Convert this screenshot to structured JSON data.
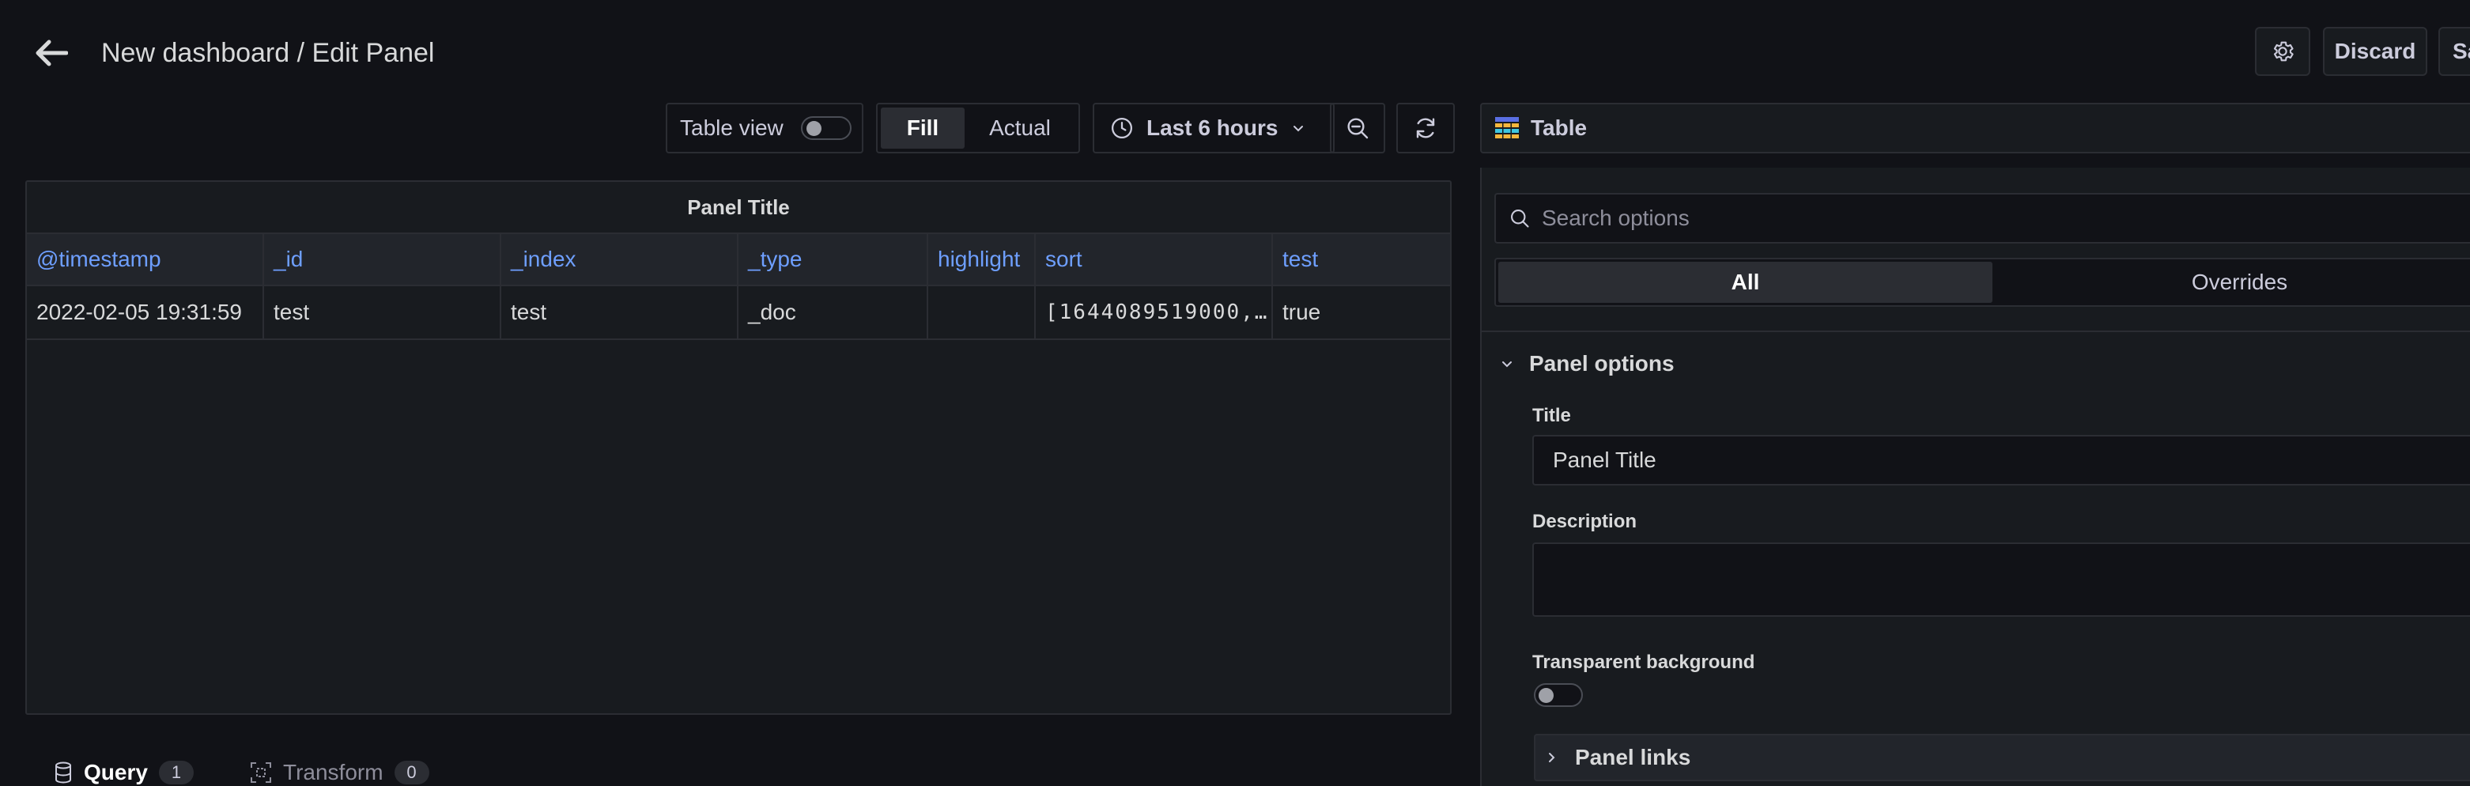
{
  "header": {
    "title": "New dashboard / Edit Panel",
    "discard_label": "Discard",
    "save_label": "Save"
  },
  "toolbar": {
    "table_view_label": "Table view",
    "table_view_on": false,
    "fill_label": "Fill",
    "actual_label": "Actual",
    "time_range_label": "Last 6 hours"
  },
  "panel": {
    "title": "Panel Title",
    "columns": [
      "@timestamp",
      "_id",
      "_index",
      "_type",
      "highlight",
      "sort",
      "test"
    ],
    "rows": [
      [
        "2022-02-05 19:31:59",
        "test",
        "test",
        "_doc",
        "",
        "[1644089519000,…",
        "true"
      ]
    ]
  },
  "bottom_tabs": {
    "query_label": "Query",
    "query_count": "1",
    "transform_label": "Transform",
    "transform_count": "0"
  },
  "options": {
    "visualization_label": "Table",
    "search_placeholder": "Search options",
    "all_label": "All",
    "overrides_label": "Overrides",
    "section_title": "Panel options",
    "title_label": "Title",
    "title_value": "Panel Title",
    "description_label": "Description",
    "description_value": "",
    "transparent_label": "Transparent background",
    "transparent_on": false,
    "panel_links_label": "Panel links"
  },
  "colors": {
    "background": "#111217",
    "panel": "#181b1f",
    "border": "#2b2d33",
    "column_header_text": "#6e9fff"
  },
  "icons": [
    "arrow-left-icon",
    "gear-icon",
    "clock-icon",
    "chevron-down-icon",
    "zoom-out-icon",
    "refresh-icon",
    "table-icon",
    "search-icon",
    "database-icon",
    "transform-icon",
    "chevron-right-icon"
  ]
}
